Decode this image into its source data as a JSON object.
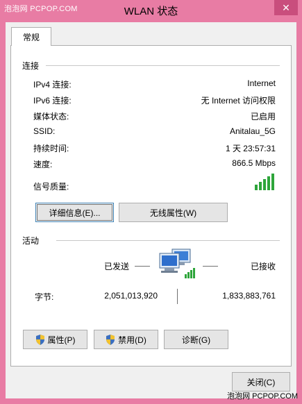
{
  "window": {
    "title": "WLAN 状态",
    "watermark_top": "泡泡网 PCPOP.COM",
    "watermark_bottom": "泡泡网 PCPOP.COM",
    "close_glyph": "✕"
  },
  "tabs": [
    {
      "label": "常规"
    }
  ],
  "connection": {
    "section_label": "连接",
    "rows": [
      {
        "label": "IPv4 连接:",
        "value": "Internet"
      },
      {
        "label": "IPv6 连接:",
        "value": "无 Internet 访问权限"
      },
      {
        "label": "媒体状态:",
        "value": "已启用"
      },
      {
        "label": "SSID:",
        "value": "Anitalau_5G"
      },
      {
        "label": "持续时间:",
        "value": "1 天 23:57:31"
      },
      {
        "label": "速度:",
        "value": "866.5 Mbps"
      },
      {
        "label": "信号质量:",
        "value": ""
      }
    ],
    "signal_level": 5,
    "signal_max": 5,
    "details_button": "详细信息(E)...",
    "wireless_props_button": "无线属性(W)"
  },
  "activity": {
    "section_label": "活动",
    "sent_label": "已发送",
    "received_label": "已接收",
    "bytes_label": "字节:",
    "bytes_sent": "2,051,013,920",
    "bytes_received": "1,833,883,761"
  },
  "actions": {
    "properties": "属性(P)",
    "disable": "禁用(D)",
    "diagnose": "诊断(G)"
  },
  "footer": {
    "close": "关闭(C)"
  },
  "colors": {
    "frame": "#e87ca4",
    "signal": "#2ea53b"
  }
}
